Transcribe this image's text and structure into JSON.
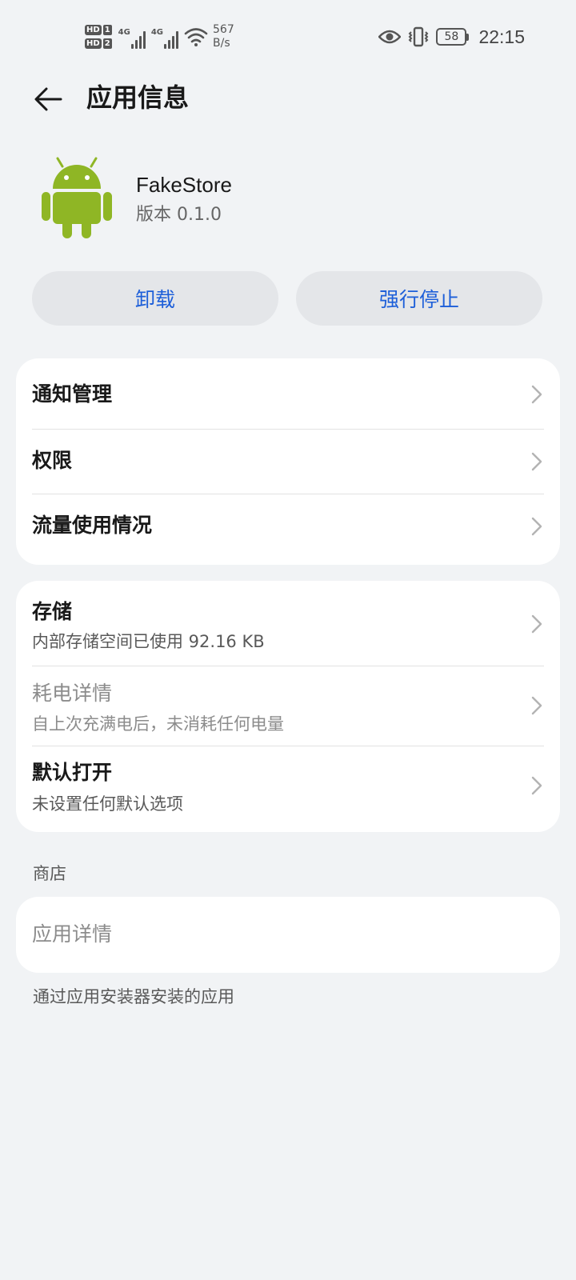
{
  "status_bar": {
    "hd1": "HD",
    "hd1_slot": "1",
    "hd2": "HD",
    "hd2_slot": "2",
    "net1": "4G",
    "net2": "4G",
    "speed_value": "567",
    "speed_unit": "B/s",
    "battery": "58",
    "time": "22:15"
  },
  "header": {
    "title": "应用信息"
  },
  "app": {
    "name": "FakeStore",
    "version": "版本 0.1.0",
    "icon_color": "#8fb625"
  },
  "actions": {
    "uninstall": "卸载",
    "force_stop": "强行停止",
    "accent": "#1d5fd9"
  },
  "settings_group_1": [
    {
      "title": "通知管理"
    },
    {
      "title": "权限"
    },
    {
      "title": "流量使用情况"
    }
  ],
  "settings_group_2": [
    {
      "title": "存储",
      "subtitle": "内部存储空间已使用 92.16 KB"
    },
    {
      "title": "耗电详情",
      "subtitle": "自上次充满电后，未消耗任何电量"
    },
    {
      "title": "默认打开",
      "subtitle": "未设置任何默认选项"
    }
  ],
  "store": {
    "section_label": "商店",
    "item": "应用详情",
    "note": "通过应用安装器安装的应用"
  }
}
